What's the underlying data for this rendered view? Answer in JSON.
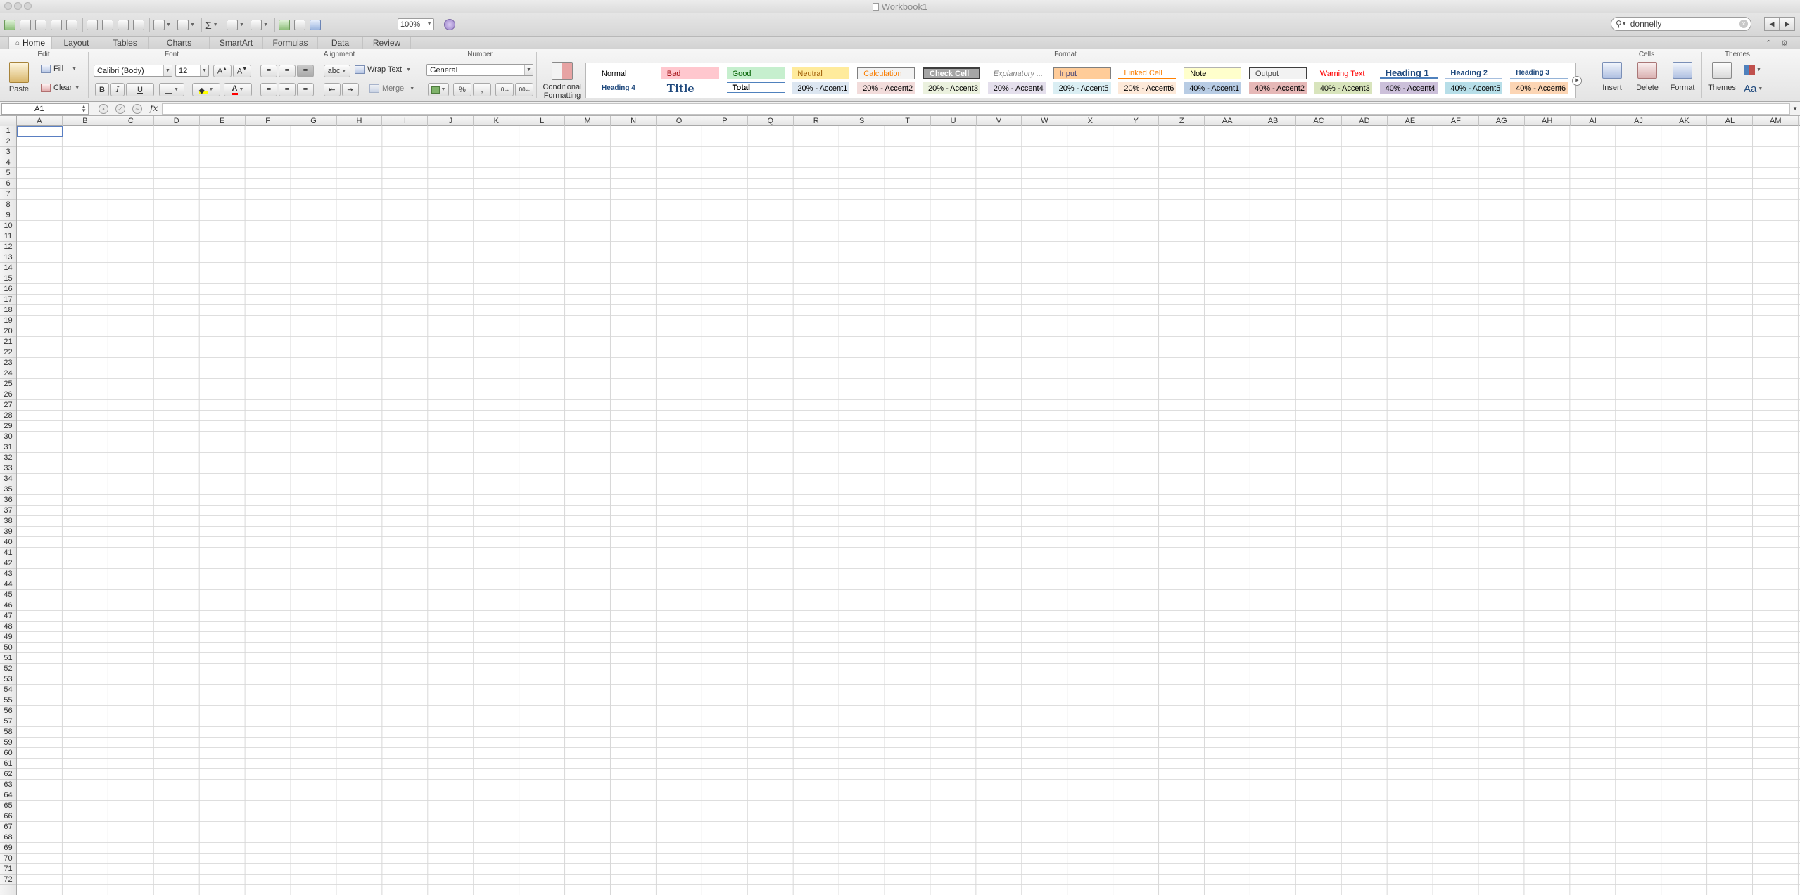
{
  "window": {
    "title": "Workbook1"
  },
  "toolbar": {
    "zoom": "100%",
    "search_value": "donnelly"
  },
  "ribbon": {
    "tabs": [
      {
        "label": "Home"
      },
      {
        "label": "Layout"
      },
      {
        "label": "Tables"
      },
      {
        "label": "Charts"
      },
      {
        "label": "SmartArt"
      },
      {
        "label": "Formulas"
      },
      {
        "label": "Data"
      },
      {
        "label": "Review"
      }
    ],
    "groups": {
      "edit": "Edit",
      "font": "Font",
      "alignment": "Alignment",
      "number": "Number",
      "format": "Format",
      "cells": "Cells",
      "themes": "Themes"
    },
    "edit": {
      "paste": "Paste",
      "fill": "Fill",
      "clear": "Clear"
    },
    "font": {
      "family": "Calibri (Body)",
      "size": "12",
      "bold": "B",
      "italic": "I",
      "underline": "U",
      "font_color": "A"
    },
    "alignment": {
      "orientation": "abc",
      "wrap_text": "Wrap Text",
      "merge": "Merge"
    },
    "number": {
      "format": "General",
      "percent": "%",
      "comma": ","
    },
    "conditional": {
      "line1": "Conditional",
      "line2": "Formatting"
    },
    "styles_row1": [
      {
        "label": "Normal",
        "bg": "#ffffff",
        "fg": "#000000",
        "border": "none"
      },
      {
        "label": "Bad",
        "bg": "#ffc7ce",
        "fg": "#9c0006",
        "border": "none"
      },
      {
        "label": "Good",
        "bg": "#c6efce",
        "fg": "#006100",
        "border": "none"
      },
      {
        "label": "Neutral",
        "bg": "#ffeb9c",
        "fg": "#9c5700",
        "border": "none"
      },
      {
        "label": "Calculation",
        "bg": "#f2f2f2",
        "fg": "#fa7d00",
        "border": "1px solid #7f7f7f"
      },
      {
        "label": "Check Cell",
        "bg": "#a5a5a5",
        "fg": "#ffffff",
        "border": "2px double #3f3f3f"
      },
      {
        "label": "Explanatory ...",
        "bg": "#ffffff",
        "fg": "#7f7f7f",
        "border": "none"
      },
      {
        "label": "Input",
        "bg": "#ffcc99",
        "fg": "#3f3f76",
        "border": "1px solid #7f7f7f"
      },
      {
        "label": "Linked Cell",
        "bg": "#ffffff",
        "fg": "#fa7d00",
        "border": "none"
      },
      {
        "label": "Note",
        "bg": "#ffffcc",
        "fg": "#000000",
        "border": "1px solid #b2b2b2"
      },
      {
        "label": "Output",
        "bg": "#f2f2f2",
        "fg": "#3f3f3f",
        "border": "1px solid #3f3f3f"
      },
      {
        "label": "Warning Text",
        "bg": "#ffffff",
        "fg": "#ff0000",
        "border": "none"
      },
      {
        "label": "Heading 1",
        "bg": "#ffffff",
        "fg": "#1f497d",
        "border": "none"
      },
      {
        "label": "Heading 2",
        "bg": "#ffffff",
        "fg": "#1f497d",
        "border": "none"
      },
      {
        "label": "Heading 3",
        "bg": "#ffffff",
        "fg": "#1f497d",
        "border": "none"
      }
    ],
    "styles_row2": [
      {
        "label": "Heading 4",
        "bg": "#ffffff",
        "fg": "#1f497d",
        "border": "none"
      },
      {
        "label": "Title",
        "bg": "#ffffff",
        "fg": "#1f497d",
        "border": "none"
      },
      {
        "label": "Total",
        "bg": "#ffffff",
        "fg": "#000000",
        "border": "none"
      },
      {
        "label": "20% - Accent1",
        "bg": "#dce6f1",
        "fg": "#000000",
        "border": "none"
      },
      {
        "label": "20% - Accent2",
        "bg": "#f2dcdb",
        "fg": "#000000",
        "border": "none"
      },
      {
        "label": "20% - Accent3",
        "bg": "#ebf1de",
        "fg": "#000000",
        "border": "none"
      },
      {
        "label": "20% - Accent4",
        "bg": "#e4dfec",
        "fg": "#000000",
        "border": "none"
      },
      {
        "label": "20% - Accent5",
        "bg": "#daeef3",
        "fg": "#000000",
        "border": "none"
      },
      {
        "label": "20% - Accent6",
        "bg": "#fde9d9",
        "fg": "#000000",
        "border": "none"
      },
      {
        "label": "40% - Accent1",
        "bg": "#b8cce4",
        "fg": "#000000",
        "border": "none"
      },
      {
        "label": "40% - Accent2",
        "bg": "#e6b8b7",
        "fg": "#000000",
        "border": "none"
      },
      {
        "label": "40% - Accent3",
        "bg": "#d8e4bc",
        "fg": "#000000",
        "border": "none"
      },
      {
        "label": "40% - Accent4",
        "bg": "#ccc0da",
        "fg": "#000000",
        "border": "none"
      },
      {
        "label": "40% - Accent5",
        "bg": "#b7dee8",
        "fg": "#000000",
        "border": "none"
      },
      {
        "label": "40% - Accent6",
        "bg": "#fcd5b4",
        "fg": "#000000",
        "border": "none"
      }
    ],
    "cells": {
      "insert": "Insert",
      "delete": "Delete",
      "format": "Format"
    },
    "themes": {
      "themes": "Themes",
      "fonts": "Aa"
    }
  },
  "formula_bar": {
    "cell_ref": "A1",
    "fx": "fx",
    "value": ""
  },
  "sheet": {
    "columns": [
      "A",
      "B",
      "C",
      "D",
      "E",
      "F",
      "G",
      "H",
      "I",
      "J",
      "K",
      "L",
      "M",
      "N",
      "O",
      "P",
      "Q",
      "R",
      "S",
      "T",
      "U",
      "V",
      "W",
      "X",
      "Y",
      "Z",
      "AA",
      "AB",
      "AC",
      "AD",
      "AE",
      "AF",
      "AG",
      "AH",
      "AI",
      "AJ",
      "AK",
      "AL",
      "AM"
    ],
    "rows": [
      "1",
      "2",
      "3",
      "4",
      "5",
      "6",
      "7",
      "8",
      "9",
      "10",
      "11",
      "12",
      "13",
      "14",
      "15",
      "16",
      "17",
      "18",
      "19",
      "20",
      "21",
      "22",
      "23",
      "24",
      "25",
      "26",
      "27",
      "28",
      "29",
      "30",
      "31",
      "32",
      "33",
      "34",
      "35",
      "36",
      "37",
      "38",
      "39",
      "40",
      "41",
      "42",
      "43",
      "44",
      "45",
      "46",
      "47",
      "48",
      "49",
      "50",
      "51",
      "52",
      "53",
      "54",
      "55",
      "56",
      "57",
      "58",
      "59",
      "60",
      "61",
      "62",
      "63",
      "64",
      "65",
      "66",
      "67",
      "68",
      "69",
      "70",
      "71",
      "72"
    ]
  }
}
